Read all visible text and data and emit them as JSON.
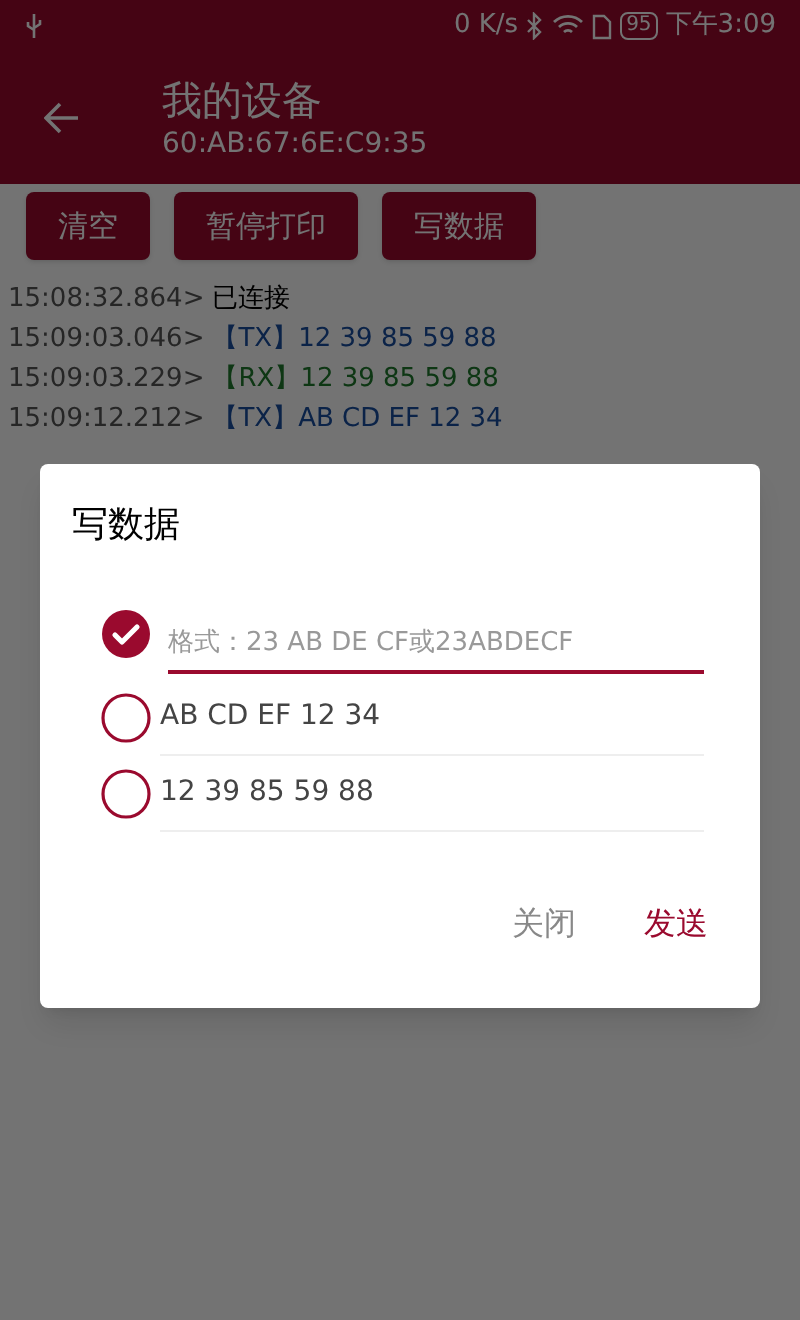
{
  "status_bar": {
    "speed": "0 K/s",
    "battery": "95",
    "time": "下午3:09"
  },
  "toolbar": {
    "title": "我的设备",
    "subtitle": "60:AB:67:6E:C9:35"
  },
  "actions": [
    "清空",
    "暂停打印",
    "写数据"
  ],
  "log": [
    {
      "time": "15:08:32.864>",
      "kind": "status",
      "text": "已连接"
    },
    {
      "time": "15:09:03.046>",
      "kind": "tx",
      "tag": "【TX】",
      "text": "12 39 85 59 88"
    },
    {
      "time": "15:09:03.229>",
      "kind": "rx",
      "tag": "【RX】",
      "text": "12 39 85 59 88"
    },
    {
      "time": "15:09:12.212>",
      "kind": "tx",
      "tag": "【TX】",
      "text": "AB CD EF 12 34"
    }
  ],
  "dialog": {
    "title": "写数据",
    "options": [
      {
        "kind": "input",
        "placeholder": "格式：23 AB DE CF或23ABDECF",
        "selected": true
      },
      {
        "kind": "text",
        "text": "AB CD EF 12 34",
        "selected": false
      },
      {
        "kind": "text",
        "text": "12 39 85 59 88",
        "selected": false
      }
    ],
    "buttons": [
      {
        "label": "关闭",
        "primary": false
      },
      {
        "label": "发送",
        "primary": true
      }
    ]
  }
}
